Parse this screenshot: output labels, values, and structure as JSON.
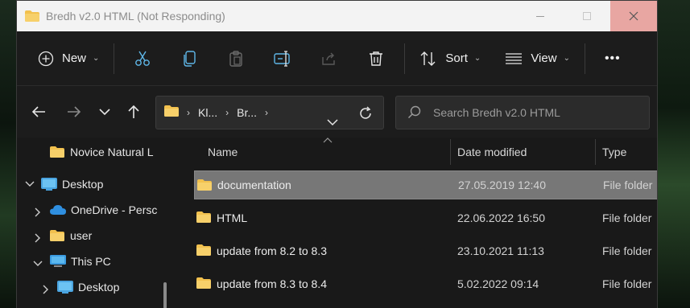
{
  "window": {
    "title": "Bredh v2.0 HTML (Not Responding)",
    "accent_close": "#e8a6a2"
  },
  "toolbar": {
    "new_label": "New",
    "sort_label": "Sort",
    "view_label": "View",
    "more_label": "•••"
  },
  "address": {
    "crumbs": [
      "Kl...",
      "Br..."
    ]
  },
  "search": {
    "placeholder": "Search Bredh v2.0 HTML"
  },
  "sidebar": {
    "items": [
      {
        "label": "Novice Natural L",
        "icon": "folder-icon"
      },
      {
        "label": "Desktop",
        "icon": "desktop-icon"
      },
      {
        "label": "OneDrive - Persc",
        "icon": "onedrive-icon"
      },
      {
        "label": "user",
        "icon": "folder-icon"
      },
      {
        "label": "This PC",
        "icon": "pc-icon"
      },
      {
        "label": "Desktop",
        "icon": "desktop-icon"
      }
    ]
  },
  "filelist": {
    "columns": [
      "Name",
      "Date modified",
      "Type"
    ],
    "rows": [
      {
        "name": "documentation",
        "date": "27.05.2019 12:40",
        "type": "File folder",
        "selected": true
      },
      {
        "name": "HTML",
        "date": "22.06.2022 16:50",
        "type": "File folder",
        "selected": false
      },
      {
        "name": "update from 8.2 to 8.3",
        "date": "23.10.2021 11:13",
        "type": "File folder",
        "selected": false
      },
      {
        "name": "update from 8.3 to 8.4",
        "date": "5.02.2022 09:14",
        "type": "File folder",
        "selected": false
      }
    ]
  },
  "colors": {
    "folder": "#f2c14e",
    "window_bg": "#202020",
    "selected_row": "#777777"
  }
}
